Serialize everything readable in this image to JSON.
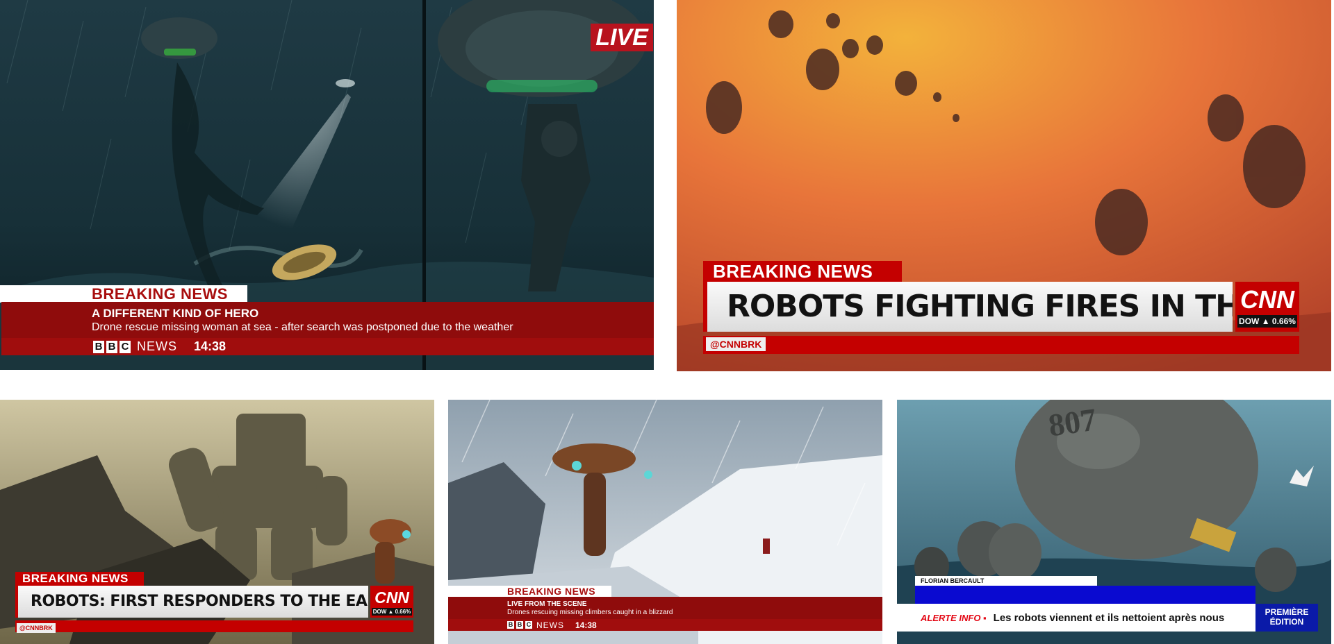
{
  "panels": {
    "bbc_hero": {
      "live_badge": "LIVE",
      "label": "BREAKING NEWS",
      "headline": "A DIFFERENT KIND OF HERO",
      "subline": "Drone rescue missing woman at sea - after search was postponed due to the weather",
      "brand_letters": [
        "B",
        "B",
        "C"
      ],
      "brand_word": "NEWS",
      "time": "14:38"
    },
    "cnn_amazon": {
      "label": "BREAKING NEWS",
      "headline": "ROBOTS FIGHTING FIRES IN THE AMAZON",
      "logo": "CNN",
      "ticker": "DOW ▲ 0.66%",
      "handle": "@CNNBRK"
    },
    "cnn_quake": {
      "label": "BREAKING NEWS",
      "headline": "ROBOTS: FIRST RESPONDERS TO THE EARTH QUAKE",
      "logo": "CNN",
      "ticker": "DOW ▲ 0.66%",
      "handle": "@CNNBRK"
    },
    "bbc_blizzard": {
      "label": "BREAKING NEWS",
      "headline": "LIVE FROM THE SCENE",
      "subline": "Drones rescuing missing climbers caught in a blizzard",
      "brand_letters": [
        "B",
        "B",
        "C"
      ],
      "brand_word": "NEWS",
      "time": "14:38"
    },
    "fr_robots": {
      "name_strap": "FLORIAN BERCAULT",
      "tag": "ALERTE INFO ▪",
      "headline": "Les robots viennent et ils nettoient après nous",
      "edition_line1": "PREMIÈRE",
      "edition_line2": "ÉDITION",
      "hull_number": "807"
    }
  },
  "colors": {
    "bbc_red": "#8f0c0c",
    "cnn_red": "#c40000",
    "fr_blue": "#0a0ad0"
  }
}
